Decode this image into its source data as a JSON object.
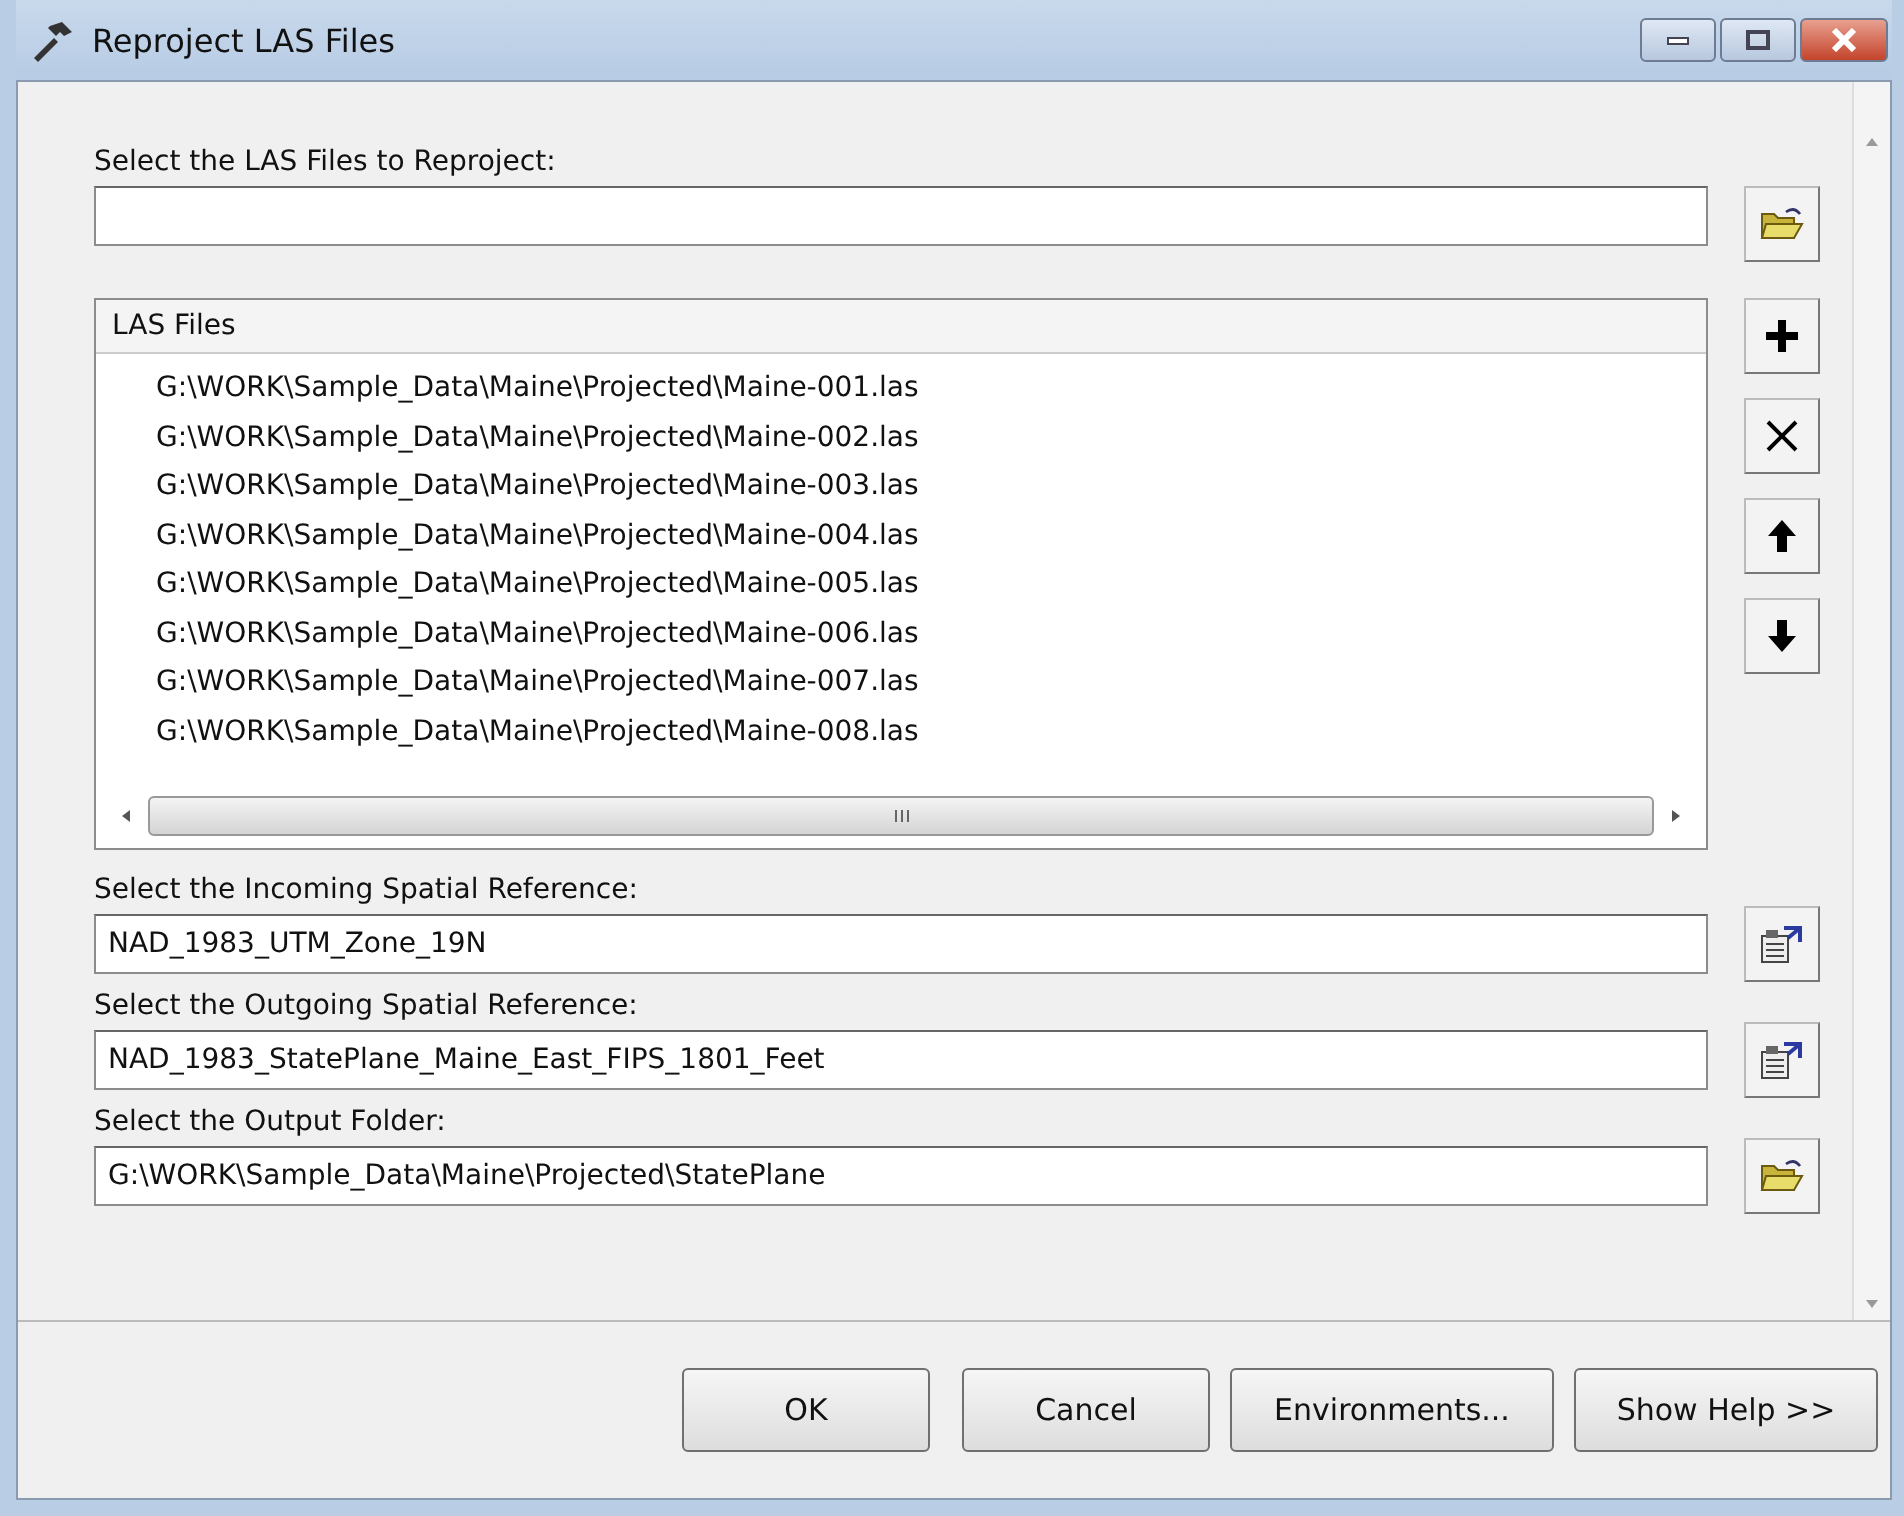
{
  "window": {
    "title": "Reproject LAS Files"
  },
  "input_files": {
    "label": "Select the LAS Files to Reproject:"
  },
  "las_files": {
    "header": "LAS Files",
    "rows": [
      "G:\\WORK\\Sample_Data\\Maine\\Projected\\Maine-001.las",
      "G:\\WORK\\Sample_Data\\Maine\\Projected\\Maine-002.las",
      "G:\\WORK\\Sample_Data\\Maine\\Projected\\Maine-003.las",
      "G:\\WORK\\Sample_Data\\Maine\\Projected\\Maine-004.las",
      "G:\\WORK\\Sample_Data\\Maine\\Projected\\Maine-005.las",
      "G:\\WORK\\Sample_Data\\Maine\\Projected\\Maine-006.las",
      "G:\\WORK\\Sample_Data\\Maine\\Projected\\Maine-007.las",
      "G:\\WORK\\Sample_Data\\Maine\\Projected\\Maine-008.las"
    ]
  },
  "fields": [
    {
      "label": "Select the Incoming Spatial Reference:",
      "value": "NAD_1983_UTM_Zone_19N",
      "kind": "spatial"
    },
    {
      "label": "Select the Outgoing Spatial Reference:",
      "value": "NAD_1983_StatePlane_Maine_East_FIPS_1801_Feet",
      "kind": "spatial"
    },
    {
      "label": "Select the Output Folder:",
      "value": "G:\\WORK\\Sample_Data\\Maine\\Projected\\StatePlane",
      "kind": "folder"
    }
  ],
  "buttons": [
    "OK",
    "Cancel",
    "Environments...",
    "Show Help >>"
  ]
}
